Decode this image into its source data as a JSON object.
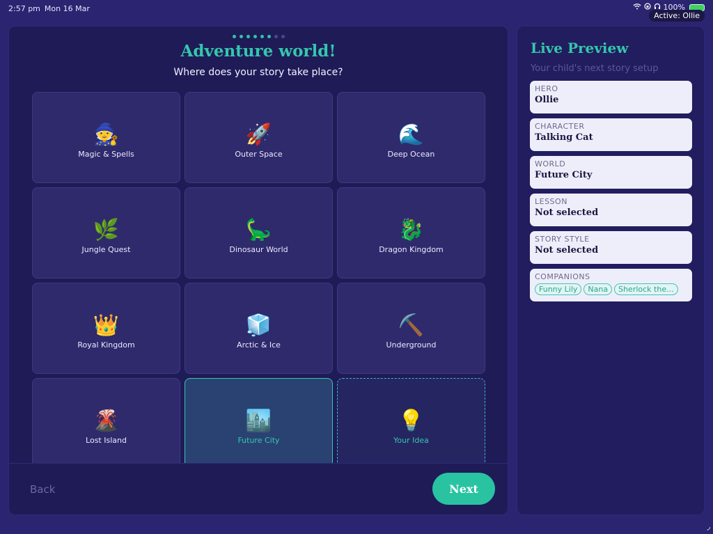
{
  "status": {
    "time": "2:57 pm",
    "date": "Mon 16 Mar",
    "battery": "100%",
    "active_user": "Active: Ollie"
  },
  "header": {
    "title": "Adventure world!",
    "subtitle": "Where does your story take place?",
    "steps_total": 8,
    "steps_done": 6
  },
  "worlds": [
    {
      "emoji": "🧙",
      "label": "Magic & Spells"
    },
    {
      "emoji": "🚀",
      "label": "Outer Space"
    },
    {
      "emoji": "🌊",
      "label": "Deep Ocean"
    },
    {
      "emoji": "🌿",
      "label": "Jungle Quest"
    },
    {
      "emoji": "🦕",
      "label": "Dinosaur World"
    },
    {
      "emoji": "🐉",
      "label": "Dragon Kingdom"
    },
    {
      "emoji": "👑",
      "label": "Royal Kingdom"
    },
    {
      "emoji": "🧊",
      "label": "Arctic & Ice"
    },
    {
      "emoji": "⛏️",
      "label": "Underground"
    },
    {
      "emoji": "🌋",
      "label": "Lost Island"
    },
    {
      "emoji": "🏙️",
      "label": "Future City"
    },
    {
      "emoji": "💡",
      "label": "Your Idea"
    }
  ],
  "footer": {
    "back_label": "Back",
    "next_label": "Next"
  },
  "preview": {
    "title": "Live Preview",
    "subtitle": "Your child's next story setup",
    "hero_key": "HERO",
    "hero_val": "Ollie",
    "character_key": "CHARACTER",
    "character_val": "Talking Cat",
    "world_key": "WORLD",
    "world_val": "Future City",
    "lesson_key": "LESSON",
    "lesson_val": "Not selected",
    "style_key": "STORY STYLE",
    "style_val": "Not selected",
    "companions_key": "COMPANIONS",
    "companions": [
      "Funny Lily",
      "Nana",
      "Sherlock the..."
    ]
  },
  "colors": {
    "accent": "#35c6ac",
    "background": "#2b2470",
    "panel": "#1f1b57"
  }
}
